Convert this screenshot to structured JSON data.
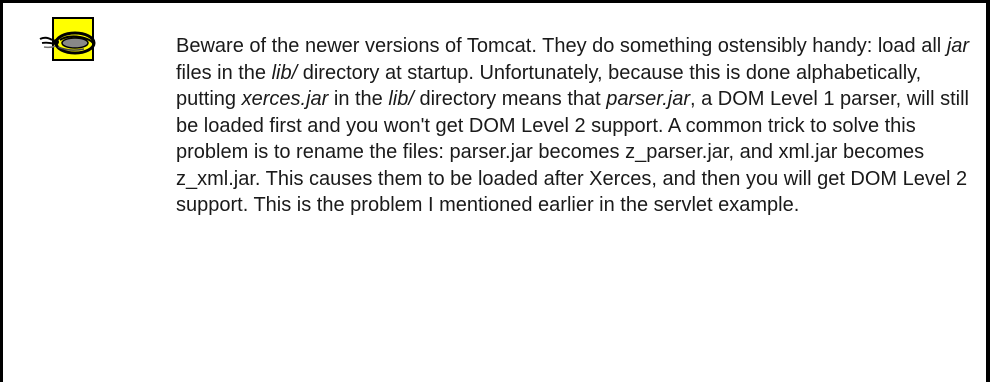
{
  "icon": {
    "name": "snake-warning-icon",
    "background": "#ffff00"
  },
  "warning": {
    "segments": [
      {
        "text": "Beware of the newer versions of Tomcat. They do something ostensibly handy: load all ",
        "italic": false
      },
      {
        "text": "jar",
        "italic": true
      },
      {
        "text": " files in the ",
        "italic": false
      },
      {
        "text": "lib/",
        "italic": true
      },
      {
        "text": " directory at startup. Unfortunately, because this is done alphabetically, putting ",
        "italic": false
      },
      {
        "text": "xerces.jar",
        "italic": true
      },
      {
        "text": " in the ",
        "italic": false
      },
      {
        "text": "lib/",
        "italic": true
      },
      {
        "text": " directory means that ",
        "italic": false
      },
      {
        "text": "parser.jar",
        "italic": true
      },
      {
        "text": ", a DOM Level 1 parser, will still be loaded first and you won't get DOM Level 2 support. A common trick to solve this problem is to rename the files: parser.jar becomes z_parser.jar, and xml.jar becomes z_xml.jar. This causes them to be loaded after Xerces, and then you will get DOM Level 2 support. This is the problem I mentioned earlier in the servlet example.",
        "italic": false
      }
    ]
  }
}
